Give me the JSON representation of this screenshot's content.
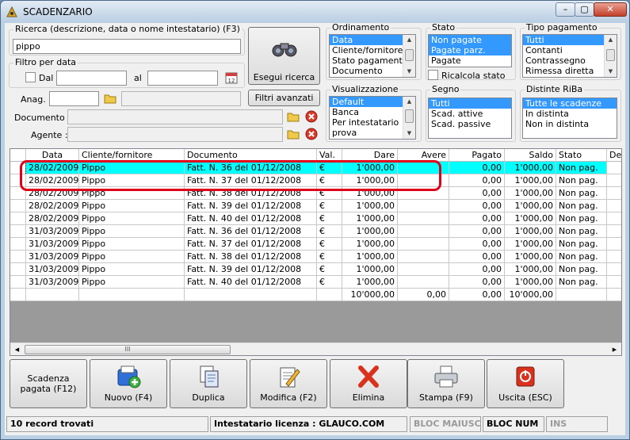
{
  "window": {
    "title": "SCADENZARIO",
    "min_label": "–",
    "max_label": "▢",
    "close_label": "✕"
  },
  "search": {
    "label": "Ricerca (descrizione, data o nome intestatario) (F3)",
    "value": "pippo",
    "exec_label": "Esegui ricerca"
  },
  "date_filter": {
    "label": "Filtro per data",
    "from_label": "Dal",
    "to_label": "al",
    "from_value": "",
    "to_value": ""
  },
  "anag": {
    "label": "Anag. :",
    "code": "",
    "name": "",
    "filters_label": "Filtri avanzati"
  },
  "documento": {
    "label": "Documento :",
    "value": ""
  },
  "agente": {
    "label": "Agente :",
    "value": ""
  },
  "ordinamento": {
    "label": "Ordinamento",
    "items": [
      "Data",
      "Cliente/fornitore",
      "Stato pagamento",
      "Documento"
    ],
    "selected": 0
  },
  "stato": {
    "label": "Stato",
    "items": [
      "Non pagate",
      "Pagate parz.",
      "Pagate"
    ],
    "recalc_label": "Ricalcola stato"
  },
  "tipo_pagamento": {
    "label": "Tipo pagamento",
    "items": [
      "Tutti",
      "Contanti",
      "Contrassegno",
      "Rimessa diretta"
    ]
  },
  "visualizzazione": {
    "label": "Visualizzazione",
    "items": [
      "Default",
      "Banca",
      "Per intestatario",
      "prova"
    ]
  },
  "segno": {
    "label": "Segno",
    "items": [
      "Tutti",
      "Scad. attive",
      "Scad. passive"
    ]
  },
  "distinte": {
    "label": "Distinte RiBa",
    "items": [
      "Tutte le scadenze",
      "In distinta",
      "Non in distinta"
    ]
  },
  "grid": {
    "columns": [
      "Data",
      "Cliente/fornitore",
      "Documento",
      "Val.",
      "Dare",
      "Avere",
      "Pagato",
      "Saldo",
      "Stato",
      "De"
    ],
    "rows": [
      [
        "28/02/2009",
        "Pippo",
        "Fatt. N. 36 del 01/12/2008",
        "€",
        "1'000,00",
        "",
        "0,00",
        "1'000,00",
        "Non pag."
      ],
      [
        "28/02/2009",
        "Pippo",
        "Fatt. N. 37 del 01/12/2008",
        "€",
        "1'000,00",
        "",
        "0,00",
        "1'000,00",
        "Non pag."
      ],
      [
        "28/02/2009",
        "Pippo",
        "Fatt. N. 38 del 01/12/2008",
        "€",
        "1'000,00",
        "",
        "0,00",
        "1'000,00",
        "Non pag."
      ],
      [
        "28/02/2009",
        "Pippo",
        "Fatt. N. 39 del 01/12/2008",
        "€",
        "1'000,00",
        "",
        "0,00",
        "1'000,00",
        "Non pag."
      ],
      [
        "28/02/2009",
        "Pippo",
        "Fatt. N. 40 del 01/12/2008",
        "€",
        "1'000,00",
        "",
        "0,00",
        "1'000,00",
        "Non pag."
      ],
      [
        "31/03/2009",
        "Pippo",
        "Fatt. N. 36 del 01/12/2008",
        "€",
        "1'000,00",
        "",
        "0,00",
        "1'000,00",
        "Non pag."
      ],
      [
        "31/03/2009",
        "Pippo",
        "Fatt. N. 37 del 01/12/2008",
        "€",
        "1'000,00",
        "",
        "0,00",
        "1'000,00",
        "Non pag."
      ],
      [
        "31/03/2009",
        "Pippo",
        "Fatt. N. 38 del 01/12/2008",
        "€",
        "1'000,00",
        "",
        "0,00",
        "1'000,00",
        "Non pag."
      ],
      [
        "31/03/2009",
        "Pippo",
        "Fatt. N. 39 del 01/12/2008",
        "€",
        "1'000,00",
        "",
        "0,00",
        "1'000,00",
        "Non pag."
      ],
      [
        "31/03/2009",
        "Pippo",
        "Fatt. N. 40 del 01/12/2008",
        "€",
        "1'000,00",
        "",
        "0,00",
        "1'000,00",
        "Non pag."
      ]
    ],
    "totals": [
      "",
      "",
      "",
      "",
      "10'000,00",
      "0,00",
      "0,00",
      "10'000,00",
      ""
    ],
    "scroll_grip": "III"
  },
  "buttons": {
    "scadenza": "Scadenza pagata (F12)",
    "nuovo": "Nuovo (F4)",
    "duplica": "Duplica",
    "modifica": "Modifica (F2)",
    "elimina": "Elimina",
    "stampa": "Stampa (F9)",
    "uscita": "Uscita (ESC)"
  },
  "status": {
    "records": "10 record trovati",
    "license": "Intestatario licenza : GLAUCO.COM",
    "maiusc": "BLOC MAIUSC",
    "num": "BLOC NUM",
    "ins": "INS"
  },
  "colors": {
    "selection": "#3399ff",
    "current_row": "#00ffff",
    "highlight": "#e0001a"
  }
}
